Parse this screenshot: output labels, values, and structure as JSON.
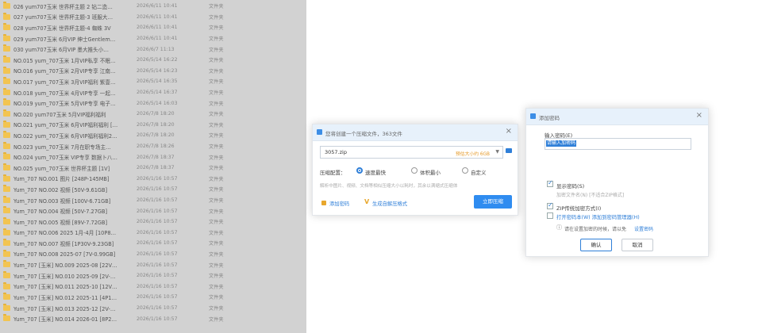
{
  "file_list": {
    "rows": [
      {
        "name": "026 yum707玉米 世界杯主题 2 钻二造…",
        "date": "2026/6/11 10:41",
        "type": "文件夹"
      },
      {
        "name": "027 yum707玉米 世界杯主题-3 班服大…",
        "date": "2026/6/11 10:41",
        "type": "文件夹"
      },
      {
        "name": "028 yum707玉米 世界杯主题-4 蜘蛛 3V",
        "date": "2026/6/11 10:41",
        "type": "文件夹"
      },
      {
        "name": "029 yum707玉米 6月VIP 绅士Gentlem…",
        "date": "2026/6/11 10:41",
        "type": "文件夹"
      },
      {
        "name": "030 yum707玉米 6月VIP 墨大推头小…",
        "date": "2026/6/7 11:13",
        "type": "文件夹"
      },
      {
        "name": "NO.015 yum_707玉米 1月VIP私享 不眠…",
        "date": "2026/5/14 16:22",
        "type": "文件夹"
      },
      {
        "name": "NO.016 yum_707玉米 2月VIP专享 江南…",
        "date": "2026/5/14 16:23",
        "type": "文件夹"
      },
      {
        "name": "NO.017 yum_707玉米 3月VIP福利 紫壹…",
        "date": "2026/5/14 16:35",
        "type": "文件夹"
      },
      {
        "name": "NO.018 yum_707玉米 4月VIP专享 一起…",
        "date": "2026/5/14 16:37",
        "type": "文件夹"
      },
      {
        "name": "NO.019 yum_707玉米 5月VIP专享 电子…",
        "date": "2026/5/14 16:03",
        "type": "文件夹"
      },
      {
        "name": "NO.020 yum707玉米 5月VIP福利福利",
        "date": "2026/7/8 18:20",
        "type": "文件夹"
      },
      {
        "name": "NO.021 yum_707玉米 6月VIP福利福利 […",
        "date": "2026/7/8 18:20",
        "type": "文件夹"
      },
      {
        "name": "NO.022 yum_707玉米 6月VIP福利福利2…",
        "date": "2026/7/8 18:20",
        "type": "文件夹"
      },
      {
        "name": "NO.023 yum_707玉米 7月在职专场主…",
        "date": "2026/7/8 18:26",
        "type": "文件夹"
      },
      {
        "name": "NO.024 yum_707玉米 VIP专享 数据卜八…",
        "date": "2026/7/8 18:37",
        "type": "文件夹"
      },
      {
        "name": "NO.025 yum_707玉米 世界杯主题 [1V]",
        "date": "2026/7/8 18:37",
        "type": "文件夹"
      },
      {
        "name": "Yum_707 NO.001 图片 [248P-145MB]",
        "date": "2026/1/16 10:57",
        "type": "文件夹"
      },
      {
        "name": "Yum_707 NO.002 视频 [50V-9.61GB]",
        "date": "2026/1/16 10:57",
        "type": "文件夹"
      },
      {
        "name": "Yum_707 NO.003 视频 [100V-6.71GB]",
        "date": "2026/1/16 10:57",
        "type": "文件夹"
      },
      {
        "name": "Yum_707 NO.004 视频 [50V-7.27GB]",
        "date": "2026/1/16 10:57",
        "type": "文件夹"
      },
      {
        "name": "Yum_707 NO.005 视频 [89V-7.72GB]",
        "date": "2026/1/16 10:57",
        "type": "文件夹"
      },
      {
        "name": "Yum_707 NO.006 2025 1月-4月 [10P8…",
        "date": "2026/1/16 10:57",
        "type": "文件夹"
      },
      {
        "name": "Yum_707 NO.007 视频 [1P30V-9.23GB]",
        "date": "2026/1/16 10:57",
        "type": "文件夹"
      },
      {
        "name": "Yum_707 NO.008 2025-07 [7V-0.99GB]",
        "date": "2026/1/16 10:57",
        "type": "文件夹"
      },
      {
        "name": "Yum_707 [玉米] NO.009 2025-08 [22V…",
        "date": "2026/1/16 10:57",
        "type": "文件夹"
      },
      {
        "name": "Yum_707 [玉米] NO.010 2025-09 [2V-…",
        "date": "2026/1/16 10:57",
        "type": "文件夹"
      },
      {
        "name": "Yum_707 [玉米] NO.011 2025-10 [12V…",
        "date": "2026/1/16 10:57",
        "type": "文件夹"
      },
      {
        "name": "Yum_707 [玉米] NO.012 2025-11 [4P1…",
        "date": "2026/1/16 10:57",
        "type": "文件夹"
      },
      {
        "name": "Yum_707 [玉米] NO.013 2025-12 [2V-…",
        "date": "2026/1/16 10:57",
        "type": "文件夹"
      },
      {
        "name": "Yum_707 [玉米] NO.014 2026-01 [8P2…",
        "date": "2026/1/16 10:57",
        "type": "文件夹"
      }
    ]
  },
  "compress_dialog": {
    "title": "您将创建一个压缩文件，363文件",
    "filename": "3057.zip",
    "size_estimate": "预估大小约 6GB",
    "config_label": "压缩配置：",
    "options": [
      "速度最快",
      "体积最小",
      "自定义"
    ],
    "hint": "解析中图片、视频、文档等相似压缩大小以耗时，其余以满缩式压缩体",
    "add_password_label": "添加密码",
    "self_extract_label": "生成自解压格式",
    "start_button": "立即压缩",
    "colors": {
      "accent": "#2f8cf0",
      "warn": "#e59a2a"
    }
  },
  "password_dialog": {
    "title": "添加密码",
    "input_label": "输入密码(E)",
    "password_value": "请输入加密码",
    "show_password_label": "显示密码(S)",
    "encrypt_names_hint": "加密文件名(N) [不适合ZIP格式]",
    "zip_compat_label": "ZIP传统加密方式(I)",
    "manager_link": "打开密码本(W) 添加到密码管理器(H)",
    "warning_text": "请在设置加密的时候，请以免",
    "warning_link": "设置密码",
    "ok_button": "确认",
    "cancel_button": "取消"
  }
}
